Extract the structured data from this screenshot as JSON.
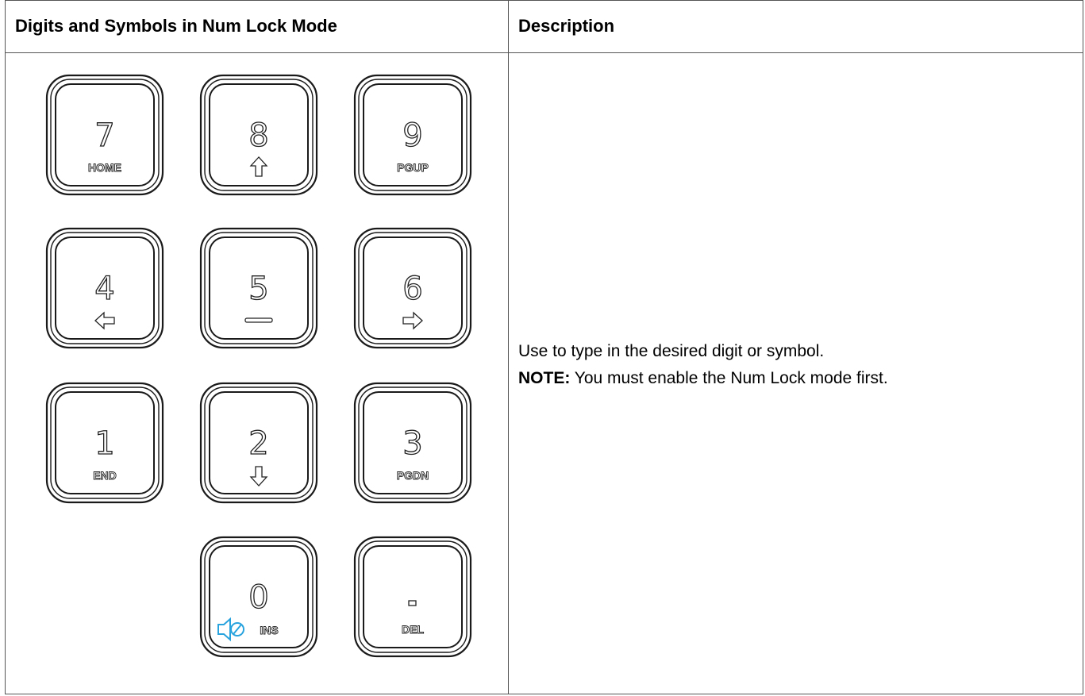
{
  "table": {
    "col1_header": "Digits and Symbols in Num Lock Mode",
    "col2_header": "Description"
  },
  "keypad": {
    "keys": [
      {
        "id": "7",
        "digit": "7",
        "legend": "HOME"
      },
      {
        "id": "8",
        "digit": "8",
        "legend_icon": "up-arrow-icon"
      },
      {
        "id": "9",
        "digit": "9",
        "legend": "PGUP"
      },
      {
        "id": "4",
        "digit": "4",
        "legend_icon": "left-arrow-icon"
      },
      {
        "id": "5",
        "digit": "5",
        "legend_icon": "dash-icon"
      },
      {
        "id": "6",
        "digit": "6",
        "legend_icon": "right-arrow-icon"
      },
      {
        "id": "1",
        "digit": "1",
        "legend": "END"
      },
      {
        "id": "2",
        "digit": "2",
        "legend_icon": "down-arrow-icon"
      },
      {
        "id": "3",
        "digit": "3",
        "legend": "PGDN"
      },
      {
        "id": "0",
        "digit": "0",
        "legend": "INS",
        "legend_icon": "speaker-icon"
      },
      {
        "id": "dot",
        "digit": ".",
        "legend": "DEL"
      }
    ],
    "colors": {
      "outline": "#1a1a1a",
      "accent": "#29a3dd"
    }
  },
  "description": {
    "line1": "Use to type in the desired digit or symbol.",
    "note_label": "NOTE:",
    "note_text": " You must enable the Num Lock mode first."
  }
}
